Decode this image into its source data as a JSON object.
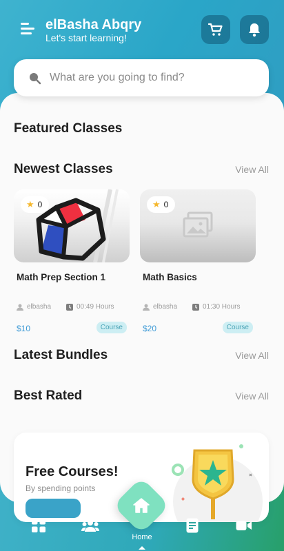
{
  "header": {
    "title": "elBasha Abqry",
    "subtitle": "Let's start learning!",
    "cart_icon": "cart-icon",
    "bell_icon": "bell-icon"
  },
  "search": {
    "placeholder": "What are you going to find?"
  },
  "sections": {
    "featured": "Featured Classes",
    "newest": "Newest Classes",
    "bundles": "Latest Bundles",
    "best_rated": "Best Rated",
    "view_all": "View All"
  },
  "courses": [
    {
      "title": "Math Prep Section 1",
      "rating": "0",
      "author": "elbasha",
      "duration": "00:49 Hours",
      "price": "$10",
      "badge": "Course"
    },
    {
      "title": "Math Basics",
      "rating": "0",
      "author": "elbasha",
      "duration": "01:30 Hours",
      "price": "$20",
      "badge": "Course"
    }
  ],
  "promo": {
    "title": "Free Courses!",
    "subtitle": "By spending points"
  },
  "nav": {
    "home_label": "Home"
  },
  "colors": {
    "accent": "#3aa3c8",
    "home_button": "#7fe1c0",
    "star": "#f5b82e"
  }
}
